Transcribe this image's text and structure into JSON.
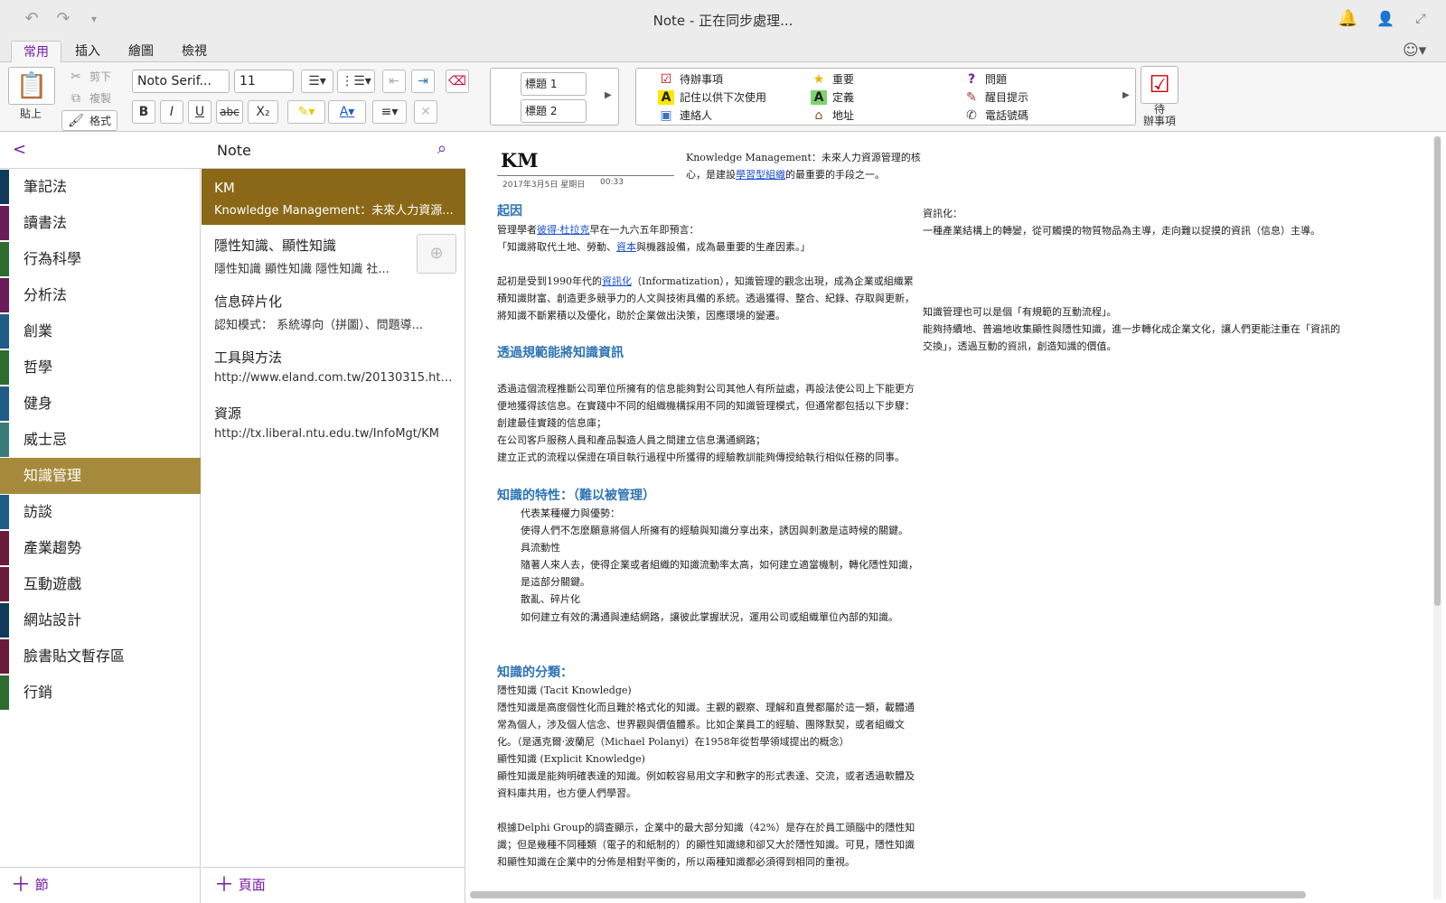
{
  "window": {
    "title": "Note - 正在同步處理..."
  },
  "tabs": [
    "常用",
    "插入",
    "繪圖",
    "檢視"
  ],
  "ribbon": {
    "paste_label": "貼上",
    "cut_label": "剪下",
    "copy_label": "複製",
    "format_label": "格式",
    "font_name": "Noto Serif...",
    "font_size": "11",
    "bold": "B",
    "italic": "I",
    "underline": "U",
    "strike": "abc",
    "subscript": "X₂",
    "styles": [
      "標題 1",
      "標題 2"
    ],
    "tags": [
      {
        "icon": "checkbox-icon",
        "label": "待辦事項"
      },
      {
        "icon": "star-icon",
        "label": "重要"
      },
      {
        "icon": "question-icon",
        "label": "問題"
      },
      {
        "icon": "highlight-a-icon",
        "label": "記住以供下次使用"
      },
      {
        "icon": "definition-a-icon",
        "label": "定義"
      },
      {
        "icon": "pen-icon",
        "label": "醒目提示"
      },
      {
        "icon": "contact-icon",
        "label": "連絡人"
      },
      {
        "icon": "house-icon",
        "label": "地址"
      },
      {
        "icon": "phone-icon",
        "label": "電話號碼"
      }
    ],
    "todo_big_label": "待\n辦事項"
  },
  "nav": {
    "back": "<",
    "title": "Note"
  },
  "sections": [
    {
      "label": "筆記法",
      "color": "#0f3a5a"
    },
    {
      "label": "讀書法",
      "color": "#6a1b5c"
    },
    {
      "label": "行為科學",
      "color": "#2e6b2e"
    },
    {
      "label": "分析法",
      "color": "#6a1b5c"
    },
    {
      "label": "創業",
      "color": "#1f5c8a"
    },
    {
      "label": "哲學",
      "color": "#2e6b2e"
    },
    {
      "label": "健身",
      "color": "#1f5c8a"
    },
    {
      "label": "威士忌",
      "color": "#3a7a78"
    },
    {
      "label": "知識管理",
      "color": "#a68a3c"
    },
    {
      "label": "訪談",
      "color": "#1f5c8a"
    },
    {
      "label": "產業趨勢",
      "color": "#6a1b3a"
    },
    {
      "label": "互動遊戲",
      "color": "#6a1b3a"
    },
    {
      "label": "網站設計",
      "color": "#0f3a5a"
    },
    {
      "label": "臉書貼文暫存區",
      "color": "#6a1b3a"
    },
    {
      "label": "行銷",
      "color": "#2e6b2e"
    }
  ],
  "add_section": "節",
  "add_page": "頁面",
  "pages": [
    {
      "title": "KM",
      "sub": "Knowledge Management：未來人力資源..."
    },
    {
      "title": "隱性知識、顯性知識",
      "sub": "隱性知識  顯性知識  隱性知識  社..."
    },
    {
      "title": "信息碎片化",
      "sub": "認知模式：  系統導向（拼圖）、問題導..."
    },
    {
      "title": "工具與方法",
      "sub": "http://www.eland.com.tw/20130315.html"
    },
    {
      "title": "資源",
      "sub": "http://tx.liberal.ntu.edu.tw/InfoMgt/KM"
    }
  ],
  "note": {
    "title": "KM",
    "date": "2017年3月5日 星期日",
    "time": "00:33",
    "intro_1": "Knowledge Management：未來人力資源管理的核",
    "intro_2a": "心，是建設",
    "intro_link": "學習型組織",
    "intro_2b": "的最重要的手段之一。",
    "h_origin": "起因",
    "o1a": "管理學者",
    "o1_link": "彼得·杜拉克",
    "o1b": "早在一九六五年即預言：",
    "o2a": "「知識將取代土地、勞動、",
    "o2_link": "資本",
    "o2b": "與機器設備，成為最重要的生產因素。」",
    "o3a": "起初是受到1990年代的",
    "o3_link": "資訊化",
    "o3b": "（Informatization），知識管理的觀念出現，成為企業或組織累",
    "o4": "積知識財富、創造更多競爭力的人文與技術具備的系統。透過獲得、整合、紀錄、存取與更新，",
    "o5": "將知識不斷累積以及優化，助於企業做出決策，因應環境的變遷。",
    "h_process": "透過規範能將知識資訊",
    "p1": "透過這個流程推斷公司單位所擁有的信息能夠對公司其他人有所益處，再設法使公司上下能更方",
    "p2": "便地獲得該信息。在實踐中不同的組織機構採用不同的知識管理模式，但通常都包括以下步驟：",
    "p3": "創建最佳實踐的信息庫；",
    "p4": "在公司客戶服務人員和產品製造人員之間建立信息溝通網路；",
    "p5": "建立正式的流程以保證在項目執行過程中所獲得的經驗教訓能夠傳授給執行相似任務的同事。",
    "h_traits": "知識的特性：（難以被管理）",
    "t1": "代表某種權力與優勢：",
    "t2": "使得人們不怎麼願意將個人所擁有的經驗與知識分享出來，誘因與刺激是這時候的關鍵。",
    "t3": "具流動性",
    "t4": "隨著人來人去，使得企業或者組織的知識流動率太高，如何建立適當機制，轉化隱性知識，",
    "t5": "是這部分關鍵。",
    "t6": "散亂、碎片化",
    "t7": "如何建立有效的溝通與連結網路，讓彼此掌握狀況，運用公司或組織單位內部的知識。",
    "h_class": "知識的分類：",
    "c1": "隱性知識 (Tacit Knowledge)",
    "c2": "隱性知識是高度個性化而且難於格式化的知識。主觀的觀察、理解和直覺都屬於這一類，載體通",
    "c3": "常為個人，涉及個人信念、世界觀與價值體系。比如企業員工的經驗、團隊默契，或者組織文",
    "c4": "化。（是邁克爾·波蘭尼（Michael Polanyi）在1958年從哲學領域提出的概念）",
    "c5": "顯性知識 (Explicit Knowledge)",
    "c6": "顯性知識是能夠明確表達的知識。例如較容易用文字和數字的形式表達、交流，或者透過軟體及",
    "c7": "資料庫共用，也方便人們學習。",
    "d1": "根據Delphi Group的調查顯示，企業中的最大部分知識（42%）是存在於員工頭腦中的隱性知",
    "d2": "識；但是幾種不同種類（電子的和紙制的）的顯性知識總和卻又大於隱性知識。可見，隱性知識",
    "d3": "和顯性知識在企業中的分佈是相對平衡的，所以兩種知識都必須得到相同的重視。",
    "r1": "資訊化：",
    "r2": "一種產業結構上的轉變，從可觸摸的物質物品為主導，走向難以捉摸的資訊（信息）主導。",
    "r3": "知識管理也可以是個「有規範的互動流程」。",
    "r4": "能夠持續地、普遍地收集顯性與隱性知識，進一步轉化成企業文化，讓人們更能注重在「資訊的",
    "r5": "交換」，透過互動的資訊，創造知識的價值。"
  },
  "colors": {
    "accent": "#7719aa",
    "active_section": "#a68a3c",
    "active_page": "#8a6818",
    "heading": "#2e74b5"
  }
}
